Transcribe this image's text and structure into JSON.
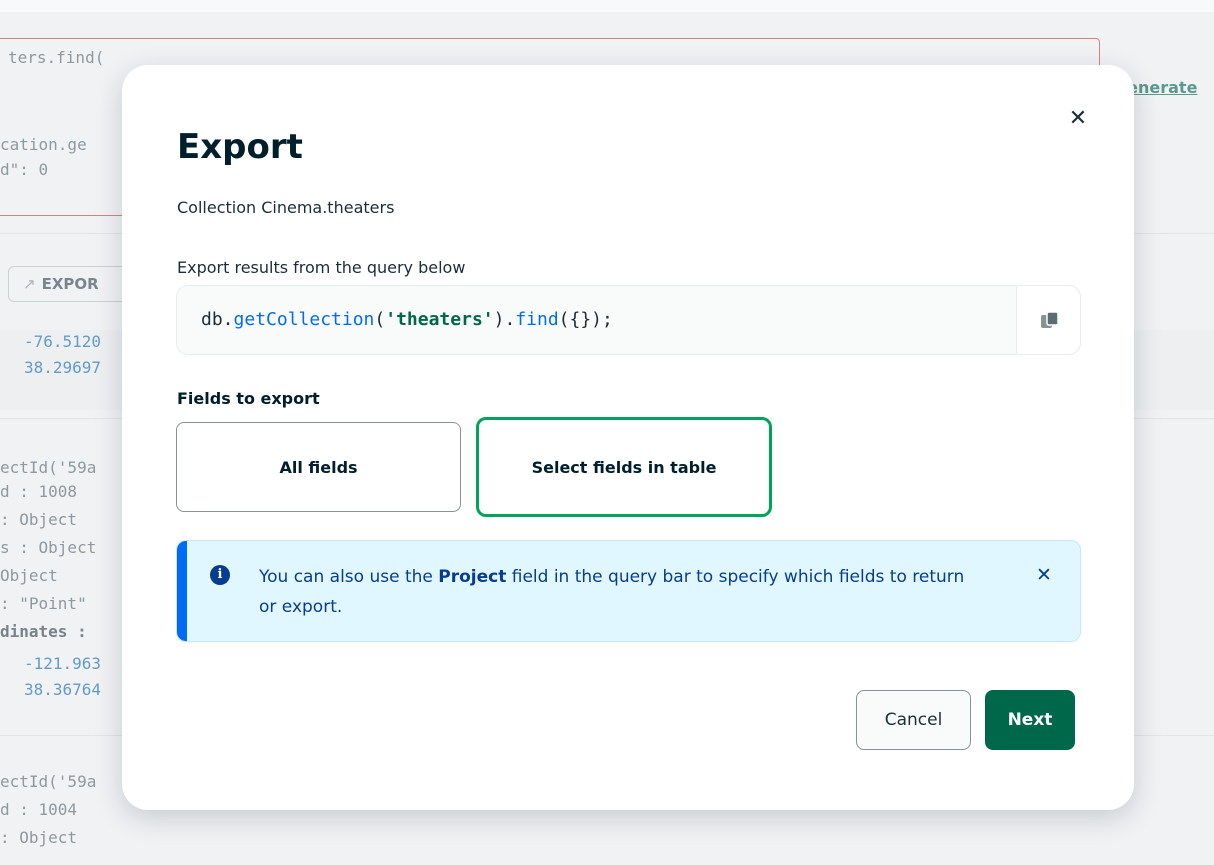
{
  "background": {
    "code_lines": [
      {
        "text": "ters.find("
      },
      {
        "text": "cation.ge"
      },
      {
        "text": "d\": 0"
      },
      {
        "text": "-76.5120"
      },
      {
        "text": "38.29697"
      },
      {
        "text": "ectId('59a"
      },
      {
        "text": "d : 1008"
      },
      {
        "text": ": Object"
      },
      {
        "text": "s : Object"
      },
      {
        "text": "Object"
      },
      {
        "text": ": \"Point\""
      },
      {
        "text": "dinates :"
      },
      {
        "text": "-121.963"
      },
      {
        "text": "38.36764"
      },
      {
        "text": "ectId('59a"
      },
      {
        "text": "d : 1004"
      },
      {
        "text": ": Object"
      }
    ],
    "generate_link": "Generate",
    "export_button": "EXPOR"
  },
  "modal": {
    "title": "Export",
    "subtitle": "Collection Cinema.theaters",
    "query_label": "Export results from the query below",
    "code": {
      "prefix": "db.",
      "fn1": "getCollection",
      "open": "(",
      "arg": "'theaters'",
      "mid": ").",
      "fn2": "find",
      "suffix": "({});"
    },
    "fields_label": "Fields to export",
    "options": [
      {
        "label": "All fields",
        "selected": false
      },
      {
        "label": "Select fields in table",
        "selected": true
      }
    ],
    "callout": {
      "before": "You can also use the ",
      "bold": "Project",
      "after": " field in the query bar to specify which fields to return or export."
    },
    "buttons": {
      "cancel": "Cancel",
      "next": "Next"
    }
  },
  "colors": {
    "primary_green": "#00684a",
    "selected_border": "#00a35c",
    "info_blue": "#016bf8",
    "callout_bg": "#e1f7ff"
  }
}
